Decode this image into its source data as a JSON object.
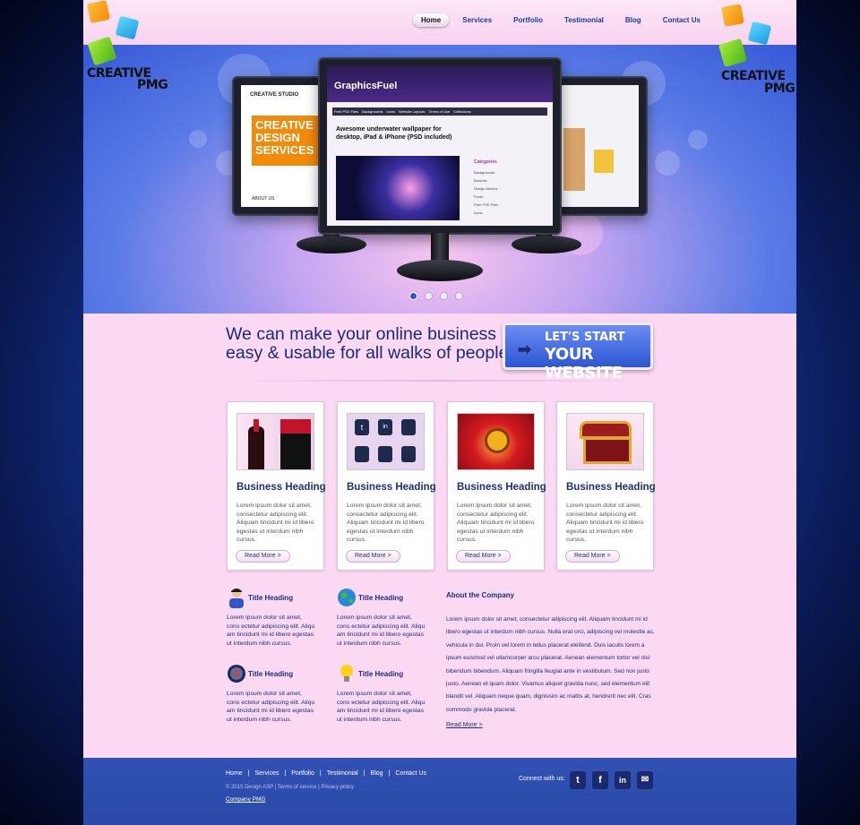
{
  "brand": {
    "text": "CREATIVE",
    "sub": "PMG"
  },
  "nav": {
    "items": [
      {
        "label": "Home",
        "active": true
      },
      {
        "label": "Services",
        "active": false
      },
      {
        "label": "Portfolio",
        "active": false
      },
      {
        "label": "Testimonial",
        "active": false
      },
      {
        "label": "Blog",
        "active": false
      },
      {
        "label": "Contact Us",
        "active": false
      }
    ]
  },
  "hero": {
    "center_screen": {
      "brand": "GraphicsFuel",
      "post_title": "Awesome underwater wallpaper for desktop, iPad & iPhone (PSD included)",
      "tabs": [
        "Free PSD Files",
        "Backgrounds",
        "Icons",
        "Website Layouts",
        "Terms of Use",
        "Collections"
      ],
      "sidebar_heading": "Categories",
      "sidebar_items": [
        "Backgrounds",
        "Brushes",
        "Design Articles",
        "Fonts",
        "Free PSD Files",
        "Icons"
      ]
    },
    "left_screen": {
      "title": "CREATIVE DESIGN SERVICES",
      "studio": "CREATIVE STUDIO",
      "footer": "ABOUT US"
    },
    "slider_dots": 4,
    "active_dot": 0
  },
  "tagline": {
    "line1": "We can make your online business",
    "line2": "easy & usable for all walks of people",
    "cta_line1": "LET'S START",
    "cta_line2": "YOUR WEBSITE"
  },
  "cards": [
    {
      "heading": "Business Heading",
      "body": "Lorem ipsum dolor sit amet, consectetur adipiscing elit. Aliquam tincidunt mi id libero egestas ut interdum nibh cursus.",
      "button": "Read More >"
    },
    {
      "heading": "Business Heading",
      "body": "Lorem ipsum dolor sit amet, consectetur adipiscing elit. Aliquam tincidunt mi id libero egestas ut interdum nibh cursus.",
      "button": "Read More >"
    },
    {
      "heading": "Business Heading",
      "body": "Lorem ipsum dolor sit amet, consectetur adipiscing elit. Aliquam tincidunt mi id libero egestas ut interdum nibh cursus.",
      "button": "Read More >"
    },
    {
      "heading": "Business Heading",
      "body": "Lorem ipsum dolor sit amet, consectetur adipiscing elit. Aliquam tincidunt mi id libero egestas ut interdum nibh cursus.",
      "button": "Read More >"
    }
  ],
  "features": [
    {
      "title": "Title Heading",
      "icon": "user-icon",
      "body": "Lorem ipsum dolor sit amet, cons ectetur adipiscing elit. Aliqu am tincidunt mi id libero egestas ut interdum nibh cursus."
    },
    {
      "title": "Title Heading",
      "icon": "globe-icon",
      "body": "Lorem ipsum dolor sit amet, cons ectetur adipiscing elit. Aliqu am tincidunt mi id libero egestas ut interdum nibh cursus."
    },
    {
      "title": "Title Heading",
      "icon": "compass-icon",
      "body": "Lorem ipsum dolor sit amet, cons ectetur adipiscing elit. Aliqu am tincidunt mi id libero egestas ut interdum nibh cursus."
    },
    {
      "title": "Title Heading",
      "icon": "lightbulb-icon",
      "body": "Lorem ipsum dolor sit amet, cons ectetur adipiscing elit. Aliqu am tincidunt mi id libero egestas ut interdum nibh cursus."
    }
  ],
  "about": {
    "heading": "About the Company",
    "body": "Lorem ipsum dolor sit amet, consectetur adipiscing elit. Aliquam tincidunt mi id libero egestas ut interdum nibh cursus. Nulla erat orci, adipiscing vel molestie ac, vehicula in dui. Proin vel lorem in tellus placerat eleifend. Duis iaculis lorem a ipsum euismod vel ullamcorper arcu placerat. Aenean elementum tortor vel nisi bibendum bibendum. Aliquam fringilla feugiat ante in vestibulum. Sed non justo justo. Aenean et quam dolor. Vivamus aliquet gravida nunc, sed elementum elit blandit vel. Aliquam neque quam, dignissim ac mattis at, hendrerit nec elit. Cras commodo gravida placerat.",
    "link": "Read More >"
  },
  "footer": {
    "nav": [
      "Home",
      "Services",
      "Portfolio",
      "Testimonial",
      "Blog",
      "Contact Us"
    ],
    "copyright": "© 2015 Design ASP | Terms of service | Privacy policy",
    "company": "Company PMG",
    "connect": "Connect with us:",
    "social": [
      "twitter-icon",
      "facebook-icon",
      "linkedin-icon",
      "mail-icon"
    ]
  },
  "colors": {
    "accent": "#2f56c9",
    "heading": "#1b2f7e",
    "page_bg": "#fbd9f2",
    "footer_bg": "#3152b4"
  }
}
